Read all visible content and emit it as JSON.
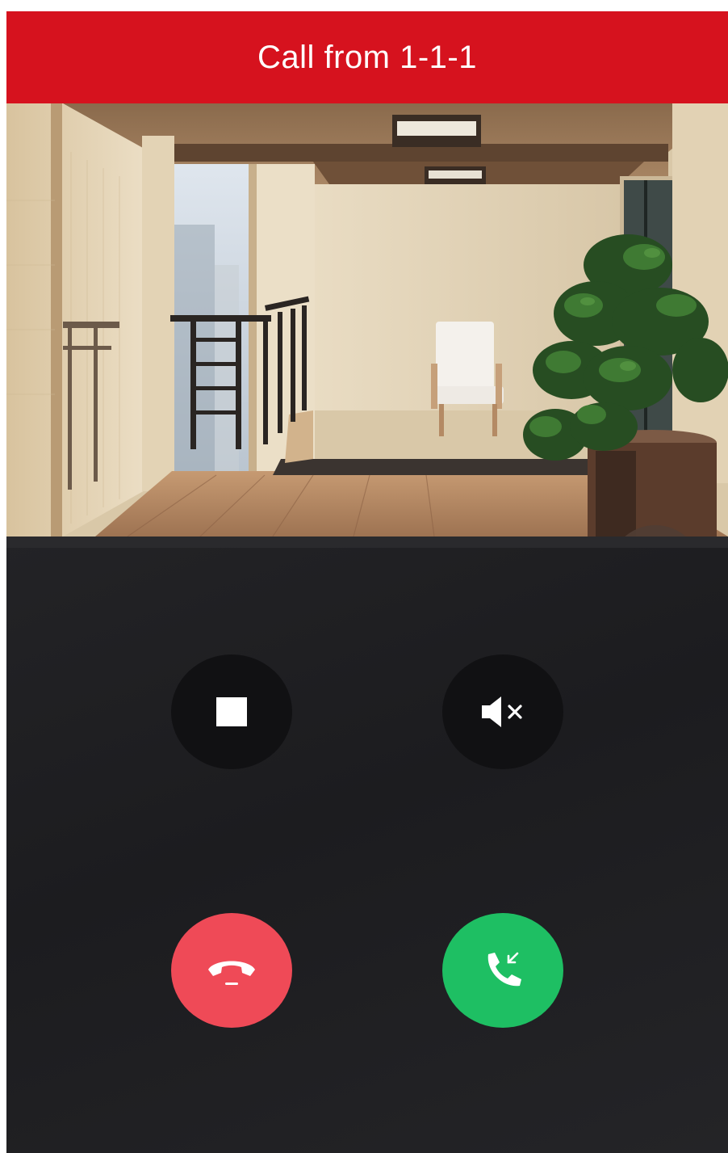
{
  "header": {
    "title": "Call from 1-1-1",
    "background_color": "#d6121e"
  },
  "video": {
    "icon": "expand-arrows-icon"
  },
  "controls": {
    "stop_icon": "stop-icon",
    "mute_icon": "speaker-mute-icon",
    "hangup_icon": "phone-hangup-icon",
    "hangup_color": "#ef4a57",
    "answer_icon": "phone-answer-icon",
    "answer_color": "#1ebf63"
  }
}
